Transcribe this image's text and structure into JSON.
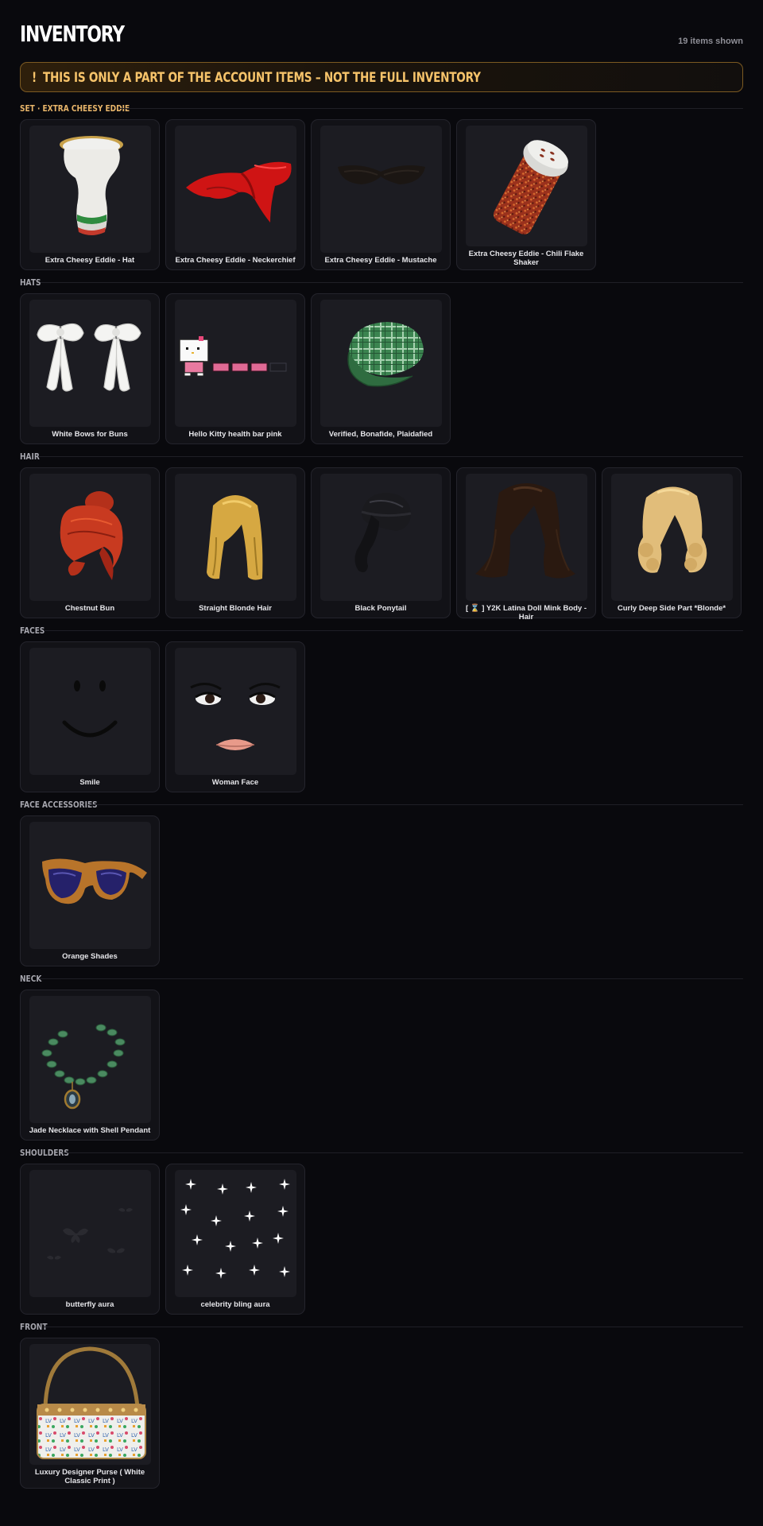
{
  "header": {
    "title": "INVENTORY",
    "count": "19 items shown"
  },
  "banner": {
    "bang": "!",
    "text": "THIS IS ONLY A PART OF THE ACCOUNT ITEMS – NOT THE FULL INVENTORY"
  },
  "sections": [
    {
      "label": "SET · EXTRA CHEESY EDDIE",
      "items": [
        {
          "name": "Extra Cheesy Eddie - Hat",
          "icon": "chef-hat-icon"
        },
        {
          "name": "Extra Cheesy Eddie - Neckerchief",
          "icon": "red-neckerchief-icon"
        },
        {
          "name": "Extra Cheesy Eddie - Mustache",
          "icon": "mustache-icon"
        },
        {
          "name": "Extra Cheesy Eddie - Chili Flake Shaker",
          "icon": "chili-shaker-icon"
        }
      ]
    },
    {
      "label": "HATS",
      "items": [
        {
          "name": "White Bows for Buns",
          "icon": "white-bows-icon"
        },
        {
          "name": "Hello Kitty health bar pink",
          "icon": "hello-kitty-healthbar-icon"
        },
        {
          "name": "Verified, Bonafide, Plaidafied",
          "icon": "plaid-cap-icon"
        }
      ]
    },
    {
      "label": "HAIR",
      "items": [
        {
          "name": "Chestnut Bun",
          "icon": "red-bun-hair-icon"
        },
        {
          "name": "Straight Blonde Hair",
          "icon": "blonde-hair-icon"
        },
        {
          "name": "Black Ponytail",
          "icon": "black-ponytail-icon"
        },
        {
          "name": "[ ⌛ ] Y2K Latina Doll Mink Body - Hair",
          "icon": "brown-long-hair-icon"
        },
        {
          "name": "Curly Deep Side Part *Blonde*",
          "icon": "curly-blonde-hair-icon"
        }
      ]
    },
    {
      "label": "FACES",
      "items": [
        {
          "name": "Smile",
          "icon": "smile-face-icon"
        },
        {
          "name": "Woman Face",
          "icon": "woman-face-icon"
        }
      ]
    },
    {
      "label": "FACE ACCESSORIES",
      "items": [
        {
          "name": "Orange Shades",
          "icon": "orange-shades-icon"
        }
      ]
    },
    {
      "label": "NECK",
      "items": [
        {
          "name": "Jade Necklace with Shell Pendant",
          "icon": "jade-necklace-icon"
        }
      ]
    },
    {
      "label": "SHOULDERS",
      "items": [
        {
          "name": "butterfly aura",
          "icon": "butterfly-aura-icon"
        },
        {
          "name": "celebrity bling aura",
          "icon": "sparkle-aura-icon"
        }
      ]
    },
    {
      "label": "FRONT",
      "items": [
        {
          "name": "Luxury Designer Purse ( White Classic Print )",
          "icon": "designer-purse-icon"
        }
      ]
    }
  ],
  "colors": {
    "background": "#09090d",
    "card": "#121217",
    "accent": "#f6c36a"
  }
}
